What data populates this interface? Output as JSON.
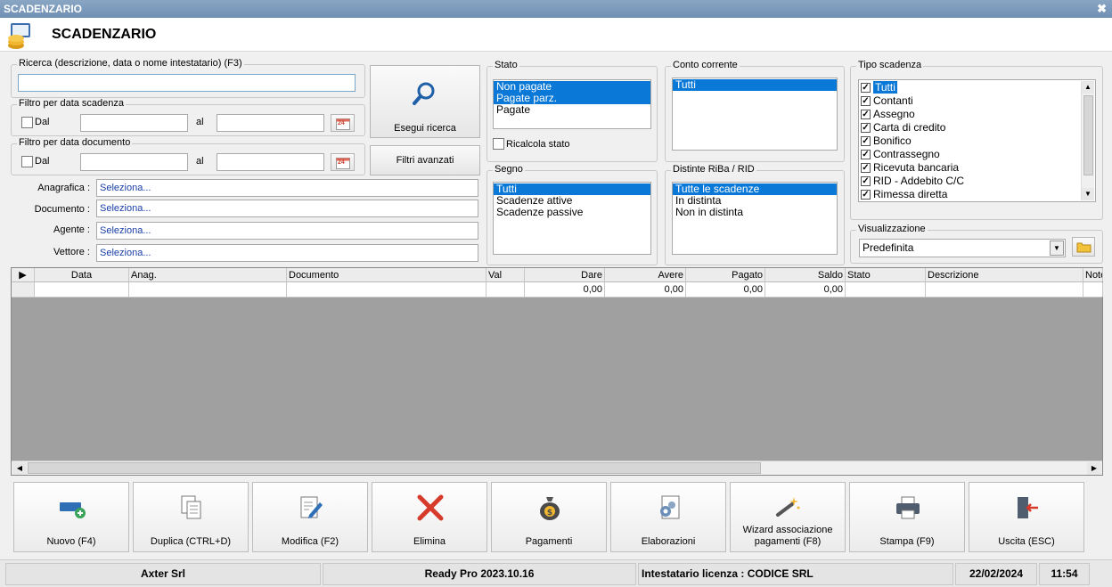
{
  "window": {
    "title": "SCADENZARIO",
    "close_glyph": "✖"
  },
  "header": {
    "title": "SCADENZARIO",
    "icon": "coins-icon"
  },
  "search": {
    "legend": "Ricerca (descrizione, data o nome intestatario) (F3)",
    "value": "",
    "button_label": "Esegui ricerca",
    "button_icon": "search-icon"
  },
  "filter_due_date": {
    "legend": "Filtro per data scadenza",
    "from_label": "Dal",
    "to_label": "al",
    "from_value": "",
    "to_value": "",
    "calendar_day": "24"
  },
  "filter_doc_date": {
    "legend": "Filtro per data documento",
    "from_label": "Dal",
    "to_label": "al",
    "from_value": "",
    "to_value": "",
    "calendar_day": "24"
  },
  "advanced_filters_label": "Filtri avanzati",
  "fields": [
    {
      "label": "Anagrafica :",
      "value": "Seleziona..."
    },
    {
      "label": "Documento :",
      "value": "Seleziona..."
    },
    {
      "label": "Agente :",
      "value": "Seleziona..."
    },
    {
      "label": "Vettore :",
      "value": "Seleziona..."
    }
  ],
  "stato": {
    "legend": "Stato",
    "items": [
      "Non pagate",
      "Pagate parz.",
      "Pagate"
    ],
    "selected": [
      0,
      1
    ],
    "recalc_label": "Ricalcola stato"
  },
  "segno": {
    "legend": "Segno",
    "items": [
      "Tutti",
      "Scadenze attive",
      "Scadenze passive"
    ],
    "selected": [
      0
    ]
  },
  "conto_corrente": {
    "legend": "Conto corrente",
    "items": [
      "Tutti"
    ],
    "selected": [
      0
    ]
  },
  "distinte": {
    "legend": "Distinte RiBa / RID",
    "items": [
      "Tutte le scadenze",
      "In distinta",
      "Non in distinta"
    ],
    "selected": [
      0
    ]
  },
  "tipo_scadenza": {
    "legend": "Tipo scadenza",
    "items": [
      "Tutti",
      "Contanti",
      "Assegno",
      "Carta di credito",
      "Bonifico",
      "Contrassegno",
      "Ricevuta bancaria",
      "RID - Addebito C/C",
      "Rimessa diretta"
    ],
    "checked": true
  },
  "visualizzazione": {
    "legend": "Visualizzazione",
    "value": "Predefinita"
  },
  "grid": {
    "columns": [
      "Data",
      "Anag.",
      "Documento",
      "Val",
      "Dare",
      "Avere",
      "Pagato",
      "Saldo",
      "Stato",
      "Descrizione",
      "Note"
    ],
    "totals": {
      "Dare": "0,00",
      "Avere": "0,00",
      "Pagato": "0,00",
      "Saldo": "0,00"
    }
  },
  "toolbar": [
    {
      "label": "Nuovo (F4)",
      "icon": "new-card-icon"
    },
    {
      "label": "Duplica (CTRL+D)",
      "icon": "duplicate-icon"
    },
    {
      "label": "Modifica (F2)",
      "icon": "edit-icon"
    },
    {
      "label": "Elimina",
      "icon": "delete-icon"
    },
    {
      "label": "Pagamenti",
      "icon": "money-bag-icon"
    },
    {
      "label": "Elaborazioni",
      "icon": "gear-document-icon"
    },
    {
      "label": "Wizard associazione pagamenti (F8)",
      "icon": "magic-wand-icon"
    },
    {
      "label": "Stampa (F9)",
      "icon": "printer-icon"
    },
    {
      "label": "Uscita (ESC)",
      "icon": "exit-icon"
    }
  ],
  "status": {
    "company": "Axter Srl",
    "product": "Ready Pro 2023.10.16",
    "license": "Intestatario licenza : CODICE SRL",
    "date": "22/02/2024",
    "time": "11:54"
  }
}
